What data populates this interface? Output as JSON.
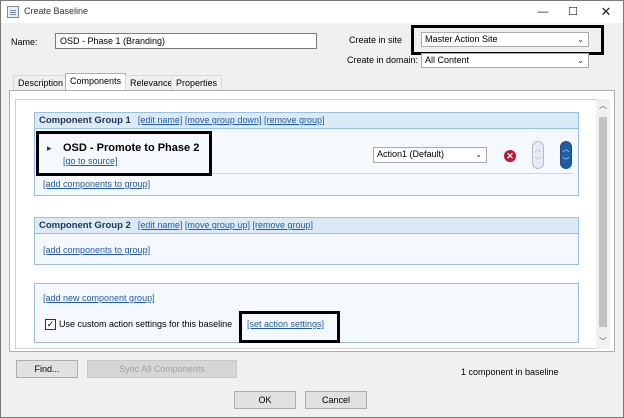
{
  "window": {
    "title": "Create Baseline",
    "min_glyph": "—",
    "max_glyph": "☐",
    "close_glyph": "✕"
  },
  "form": {
    "name_label": "Name:",
    "name_value": "OSD - Phase 1 (Branding)",
    "create_in_site_label": "Create in site",
    "create_in_site_value": "Master Action Site",
    "create_in_domain_label": "Create in domain:",
    "create_in_domain_value": "All Content"
  },
  "tabs": [
    {
      "label": "Description"
    },
    {
      "label": "Components"
    },
    {
      "label": "Relevance"
    },
    {
      "label": "Properties"
    }
  ],
  "group1": {
    "title": "Component Group 1",
    "edit_name": "[edit name]",
    "move": "[move group down]",
    "remove": "[remove group]",
    "component_name": "OSD - Promote to Phase 2",
    "go_to_source": "[go to source]",
    "action_value": "Action1 (Default)",
    "add_components": "[add components to group]"
  },
  "group2": {
    "title": "Component Group 2",
    "edit_name": "[edit name]",
    "move": "[move group up]",
    "remove": "[remove group]",
    "add_components": "[add components to group]"
  },
  "footer_group": {
    "add_new_group": "[add new component group]",
    "custom_action_label": "Use custom action settings for this baseline",
    "set_action_settings": "[set action settings]",
    "checked": true
  },
  "bottom": {
    "find_label": "Find...",
    "sync_label": "Sync All Components",
    "status": "1 component in baseline",
    "ok_label": "OK",
    "cancel_label": "Cancel"
  },
  "icons": {
    "expand_glyph": "▸",
    "combo_glyph": "⌄",
    "remove_glyph": "✕",
    "up_glyph": "︿",
    "down_glyph": "﹀",
    "scroll_up": "︿",
    "scroll_down": "﹀",
    "check_glyph": "✓"
  }
}
